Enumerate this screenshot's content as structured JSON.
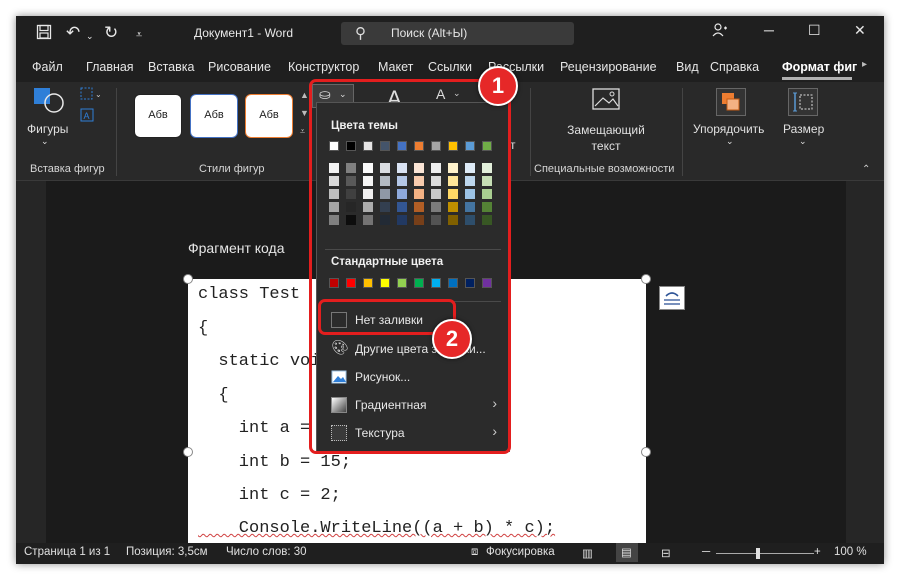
{
  "title_bar": {
    "doc_title": "Документ1  -  Word",
    "search_text": "Поиск (Alt+Ы)"
  },
  "tabs": [
    "Файл",
    "Главная",
    "Вставка",
    "Рисование",
    "Конструктор",
    "Макет",
    "Ссылки",
    "Рассылки",
    "Рецензирование",
    "Вид",
    "Справка",
    "Формат фиг"
  ],
  "ribbon": {
    "shapes_label": "Фигуры",
    "group_insert": "Вставка фигур",
    "style_sample": "Абв",
    "group_styles": "Стили фигур",
    "alt_text_label": "Замещающий текст",
    "group_special": "Специальные возможности",
    "arrange_label": "Упорядочить",
    "size_label": "Размер"
  },
  "document": {
    "fragment_label": "Фрагмент кода",
    "code_lines": [
      "class Test",
      "{",
      "  static void",
      "  {",
      "    int a = 1",
      "    int b = 15;",
      "    int c = 2;",
      "    Console.WriteLine((a + b) * c);"
    ]
  },
  "fill_menu": {
    "theme_colors_title": "Цвета темы",
    "theme_colors": [
      "#ffffff",
      "#000000",
      "#e7e6e6",
      "#44546a",
      "#4472c4",
      "#ed7d31",
      "#a5a5a5",
      "#ffc000",
      "#5b9bd5",
      "#70ad47"
    ],
    "standard_colors_title": "Стандартные цвета",
    "standard_colors": [
      "#c00000",
      "#ff0000",
      "#ffc000",
      "#ffff00",
      "#92d050",
      "#00b050",
      "#00b0f0",
      "#0070c0",
      "#002060",
      "#7030a0"
    ],
    "items": {
      "no_fill": "Нет заливки",
      "more_colors": "Другие цвета заливки...",
      "picture": "Рисунок...",
      "gradient": "Градиентная",
      "texture": "Текстура"
    }
  },
  "annotations": {
    "badge1": "1",
    "badge2": "2"
  },
  "status_bar": {
    "page": "Страница 1 из 1",
    "position": "Позиция: 3,5см",
    "words": "Число слов: 30",
    "focus": "Фокусировка",
    "zoom": "100 %"
  }
}
